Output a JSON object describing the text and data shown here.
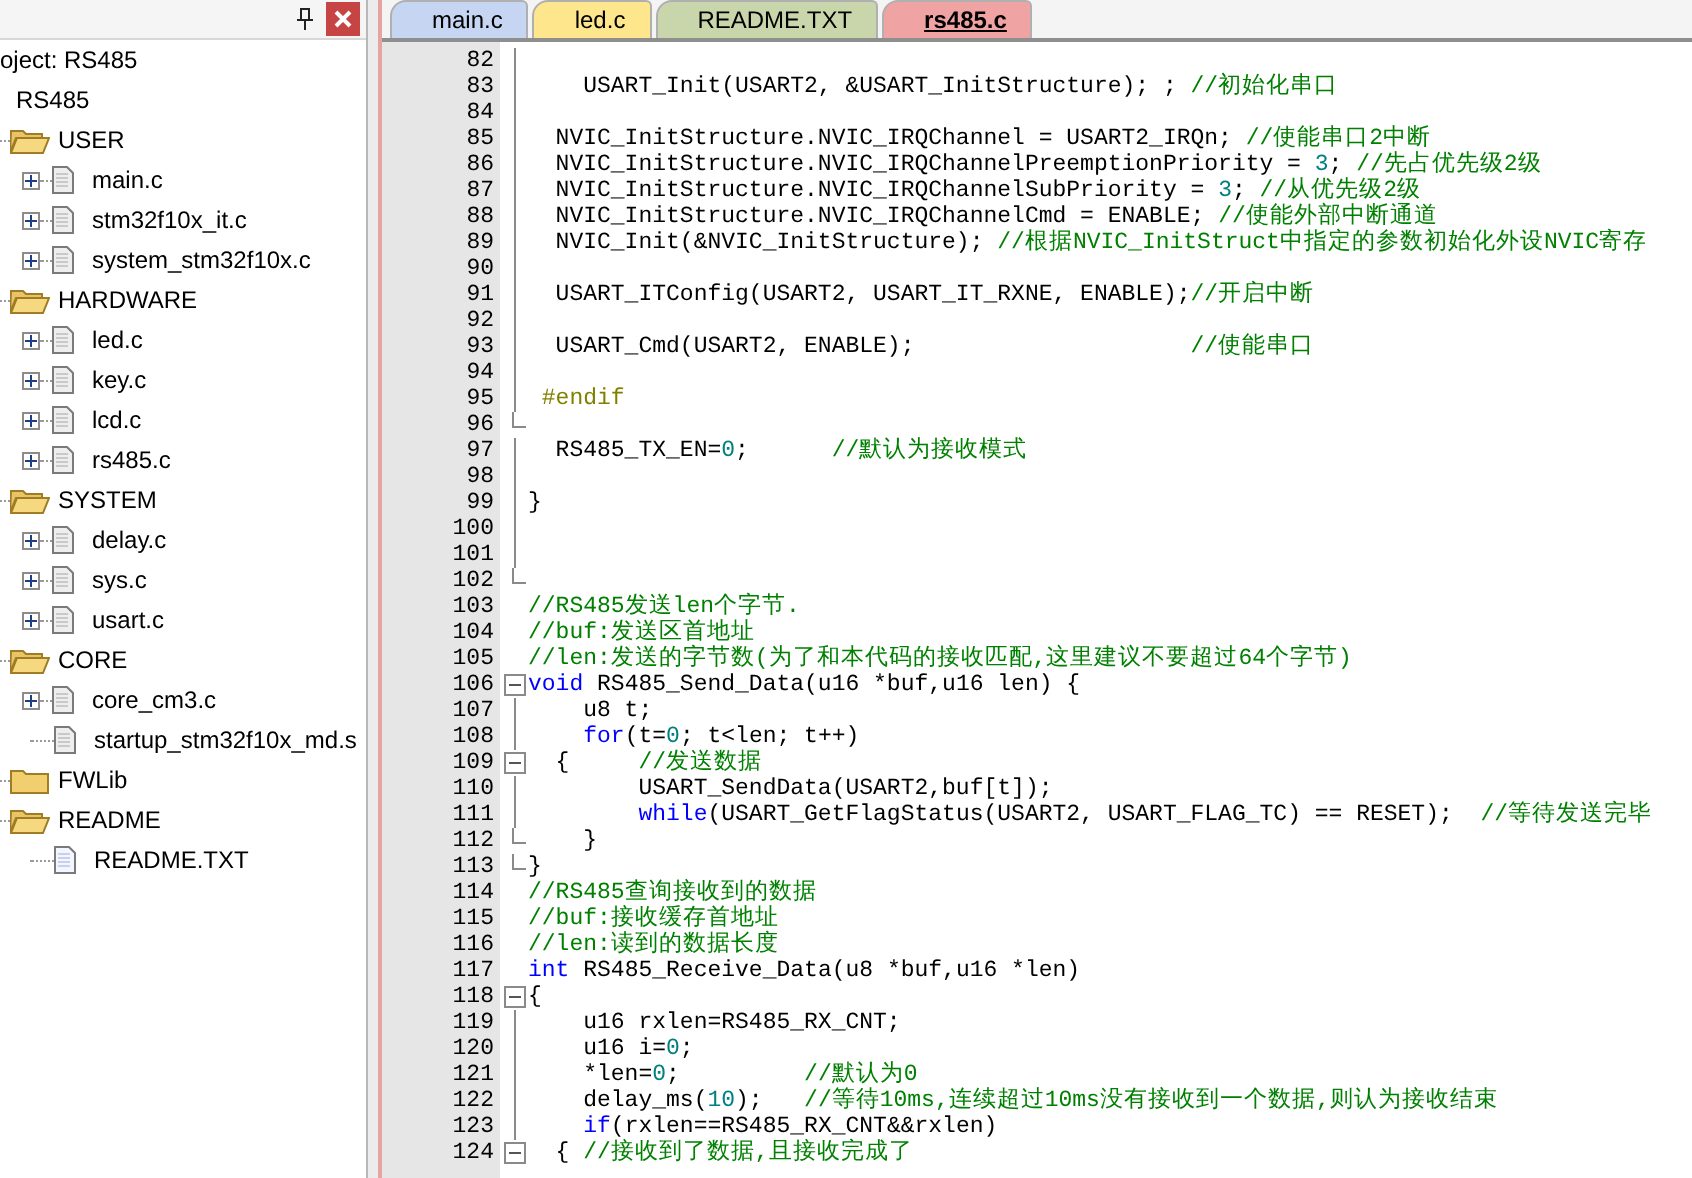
{
  "project_panel": {
    "tree": [
      {
        "label": "oject: RS485",
        "kind": "project",
        "expanded": true,
        "children": [
          {
            "label": "RS485",
            "kind": "target",
            "expanded": true,
            "children": [
              {
                "label": "USER",
                "kind": "folder",
                "expanded": true,
                "children": [
                  {
                    "label": "main.c",
                    "kind": "file",
                    "expandable": true
                  },
                  {
                    "label": "stm32f10x_it.c",
                    "kind": "file",
                    "expandable": true
                  },
                  {
                    "label": "system_stm32f10x.c",
                    "kind": "file",
                    "expandable": true
                  }
                ]
              },
              {
                "label": "HARDWARE",
                "kind": "folder",
                "expanded": true,
                "children": [
                  {
                    "label": "led.c",
                    "kind": "file",
                    "expandable": true
                  },
                  {
                    "label": "key.c",
                    "kind": "file",
                    "expandable": true
                  },
                  {
                    "label": "lcd.c",
                    "kind": "file",
                    "expandable": true
                  },
                  {
                    "label": "rs485.c",
                    "kind": "file",
                    "expandable": true
                  }
                ]
              },
              {
                "label": "SYSTEM",
                "kind": "folder",
                "expanded": true,
                "children": [
                  {
                    "label": "delay.c",
                    "kind": "file",
                    "expandable": true
                  },
                  {
                    "label": "sys.c",
                    "kind": "file",
                    "expandable": true
                  },
                  {
                    "label": "usart.c",
                    "kind": "file",
                    "expandable": true
                  }
                ]
              },
              {
                "label": "CORE",
                "kind": "folder",
                "expanded": true,
                "children": [
                  {
                    "label": "core_cm3.c",
                    "kind": "file",
                    "expandable": true
                  },
                  {
                    "label": "startup_stm32f10x_md.s",
                    "kind": "file",
                    "expandable": false
                  }
                ]
              },
              {
                "label": "FWLib",
                "kind": "folder",
                "expanded": false
              },
              {
                "label": "README",
                "kind": "folder",
                "expanded": true,
                "children": [
                  {
                    "label": "README.TXT",
                    "kind": "text",
                    "expandable": false
                  }
                ]
              }
            ]
          }
        ]
      }
    ]
  },
  "tabs": [
    {
      "label": "main.c",
      "color": "#c6d5f1",
      "selected": false
    },
    {
      "label": "led.c",
      "color": "#fde68c",
      "selected": false
    },
    {
      "label": "README.TXT",
      "color": "#c9d5ab",
      "selected": false
    },
    {
      "label": "rs485.c",
      "color": "#f0a3a3",
      "selected": true
    }
  ],
  "editor": {
    "lines": [
      {
        "num": "82",
        "kind": "mid"
      },
      {
        "num": "83",
        "kind": "mid",
        "tokens": [
          {
            "kind": "code",
            "text": "    USART_Init(USART2, &USART_InitStructure); ; "
          },
          {
            "kind": "comment",
            "text": "//初始化串口"
          }
        ]
      },
      {
        "num": "84",
        "kind": "mid"
      },
      {
        "num": "85",
        "kind": "mid",
        "tokens": [
          {
            "kind": "code",
            "text": "  NVIC_InitStructure.NVIC_IRQChannel = USART2_IRQn; "
          },
          {
            "kind": "comment",
            "text": "//使能串口2中断"
          }
        ]
      },
      {
        "num": "86",
        "kind": "mid",
        "tokens": [
          {
            "kind": "code",
            "text": "  NVIC_InitStructure.NVIC_IRQChannelPreemptionPriority = "
          },
          {
            "kind": "number",
            "text": "3"
          },
          {
            "kind": "code",
            "text": "; "
          },
          {
            "kind": "comment",
            "text": "//先占优先级2级"
          }
        ]
      },
      {
        "num": "87",
        "kind": "mid",
        "tokens": [
          {
            "kind": "code",
            "text": "  NVIC_InitStructure.NVIC_IRQChannelSubPriority = "
          },
          {
            "kind": "number",
            "text": "3"
          },
          {
            "kind": "code",
            "text": "; "
          },
          {
            "kind": "comment",
            "text": "//从优先级2级"
          }
        ]
      },
      {
        "num": "88",
        "kind": "mid",
        "tokens": [
          {
            "kind": "code",
            "text": "  NVIC_InitStructure.NVIC_IRQChannelCmd = ENABLE; "
          },
          {
            "kind": "comment",
            "text": "//使能外部中断通道"
          }
        ]
      },
      {
        "num": "89",
        "kind": "mid",
        "tokens": [
          {
            "kind": "code",
            "text": "  NVIC_Init(&NVIC_InitStructure); "
          },
          {
            "kind": "comment",
            "text": "//根据NVIC_InitStruct中指定的参数初始化外设NVIC寄存"
          }
        ]
      },
      {
        "num": "90",
        "kind": "mid"
      },
      {
        "num": "91",
        "kind": "mid",
        "tokens": [
          {
            "kind": "code",
            "text": "  USART_ITConfig(USART2, USART_IT_RXNE, ENABLE);"
          },
          {
            "kind": "comment",
            "text": "//开启中断"
          }
        ]
      },
      {
        "num": "92",
        "kind": "mid"
      },
      {
        "num": "93",
        "kind": "mid",
        "tokens": [
          {
            "kind": "code",
            "text": "  USART_Cmd(USART2, ENABLE);                    "
          },
          {
            "kind": "comment",
            "text": "//使能串口"
          }
        ]
      },
      {
        "num": "94",
        "kind": "mid"
      },
      {
        "num": "95",
        "kind": "mid",
        "tokens": [
          {
            "kind": "preproc",
            "text": " #endif"
          }
        ]
      },
      {
        "num": "96",
        "kind": "end"
      },
      {
        "num": "97",
        "kind": "mid",
        "tokens": [
          {
            "kind": "code",
            "text": "  RS485_TX_EN="
          },
          {
            "kind": "number",
            "text": "0"
          },
          {
            "kind": "code",
            "text": ";      "
          },
          {
            "kind": "comment",
            "text": "//默认为接收模式"
          }
        ]
      },
      {
        "num": "98",
        "kind": "mid"
      },
      {
        "num": "99",
        "kind": "mid",
        "tokens": [
          {
            "kind": "code",
            "text": "}"
          }
        ]
      },
      {
        "num": "100",
        "kind": "mid"
      },
      {
        "num": "101",
        "kind": "mid"
      },
      {
        "num": "102",
        "kind": "end"
      },
      {
        "num": "103",
        "kind": "none",
        "tokens": [
          {
            "kind": "comment",
            "text": "//RS485发送len个字节."
          }
        ]
      },
      {
        "num": "104",
        "kind": "none",
        "tokens": [
          {
            "kind": "comment",
            "text": "//buf:发送区首地址"
          }
        ]
      },
      {
        "num": "105",
        "kind": "none",
        "tokens": [
          {
            "kind": "comment",
            "text": "//len:发送的字节数(为了和本代码的接收匹配,这里建议不要超过64个字节)"
          }
        ]
      },
      {
        "num": "106",
        "kind": "start",
        "tokens": [
          {
            "kind": "keyword",
            "text": "void"
          },
          {
            "kind": "code",
            "text": " RS485_Send_Data(u16 *buf,u16 len) {"
          }
        ]
      },
      {
        "num": "107",
        "kind": "mid",
        "tokens": [
          {
            "kind": "code",
            "text": "    u8 t;"
          }
        ]
      },
      {
        "num": "108",
        "kind": "mid",
        "tokens": [
          {
            "kind": "keyword",
            "text": "    for"
          },
          {
            "kind": "code",
            "text": "(t="
          },
          {
            "kind": "number",
            "text": "0"
          },
          {
            "kind": "code",
            "text": "; t<len; t++)"
          }
        ]
      },
      {
        "num": "109",
        "kind": "start",
        "tokens": [
          {
            "kind": "code",
            "text": "  {     "
          },
          {
            "kind": "comment",
            "text": "//发送数据"
          }
        ]
      },
      {
        "num": "110",
        "kind": "mid",
        "tokens": [
          {
            "kind": "code",
            "text": "        USART_SendData(USART2,buf[t]);"
          }
        ]
      },
      {
        "num": "111",
        "kind": "mid",
        "tokens": [
          {
            "kind": "keyword",
            "text": "        while"
          },
          {
            "kind": "code",
            "text": "(USART_GetFlagStatus(USART2, USART_FLAG_TC) == RESET);  "
          },
          {
            "kind": "comment",
            "text": "//等待发送完毕"
          }
        ]
      },
      {
        "num": "112",
        "kind": "end",
        "tokens": [
          {
            "kind": "code",
            "text": "    }"
          }
        ]
      },
      {
        "num": "113",
        "kind": "end",
        "tokens": [
          {
            "kind": "code",
            "text": "}"
          }
        ]
      },
      {
        "num": "114",
        "kind": "none",
        "tokens": [
          {
            "kind": "comment",
            "text": "//RS485查询接收到的数据"
          }
        ]
      },
      {
        "num": "115",
        "kind": "none",
        "tokens": [
          {
            "kind": "comment",
            "text": "//buf:接收缓存首地址"
          }
        ]
      },
      {
        "num": "116",
        "kind": "none",
        "tokens": [
          {
            "kind": "comment",
            "text": "//len:读到的数据长度"
          }
        ]
      },
      {
        "num": "117",
        "kind": "none",
        "tokens": [
          {
            "kind": "keyword",
            "text": "int"
          },
          {
            "kind": "code",
            "text": " RS485_Receive_Data(u8 *buf,u16 *len)"
          }
        ]
      },
      {
        "num": "118",
        "kind": "start",
        "tokens": [
          {
            "kind": "code",
            "text": "{"
          }
        ]
      },
      {
        "num": "119",
        "kind": "mid",
        "tokens": [
          {
            "kind": "code",
            "text": "    u16 rxlen=RS485_RX_CNT;"
          }
        ]
      },
      {
        "num": "120",
        "kind": "mid",
        "tokens": [
          {
            "kind": "code",
            "text": "    u16 i="
          },
          {
            "kind": "number",
            "text": "0"
          },
          {
            "kind": "code",
            "text": ";"
          }
        ]
      },
      {
        "num": "121",
        "kind": "mid",
        "tokens": [
          {
            "kind": "code",
            "text": "    *len="
          },
          {
            "kind": "number",
            "text": "0"
          },
          {
            "kind": "code",
            "text": ";         "
          },
          {
            "kind": "comment",
            "text": "//默认为0"
          }
        ]
      },
      {
        "num": "122",
        "kind": "mid",
        "tokens": [
          {
            "kind": "code",
            "text": "    delay_ms("
          },
          {
            "kind": "number",
            "text": "10"
          },
          {
            "kind": "code",
            "text": ");   "
          },
          {
            "kind": "comment",
            "text": "//等待10ms,连续超过10ms没有接收到一个数据,则认为接收结束"
          }
        ]
      },
      {
        "num": "123",
        "kind": "mid",
        "tokens": [
          {
            "kind": "keyword",
            "text": "    if"
          },
          {
            "kind": "code",
            "text": "(rxlen==RS485_RX_CNT&&rxlen)"
          }
        ]
      },
      {
        "num": "124",
        "kind": "start",
        "tokens": [
          {
            "kind": "code",
            "text": "  { "
          },
          {
            "kind": "comment",
            "text": "//接收到了数据,且接收完成了"
          }
        ]
      }
    ]
  }
}
